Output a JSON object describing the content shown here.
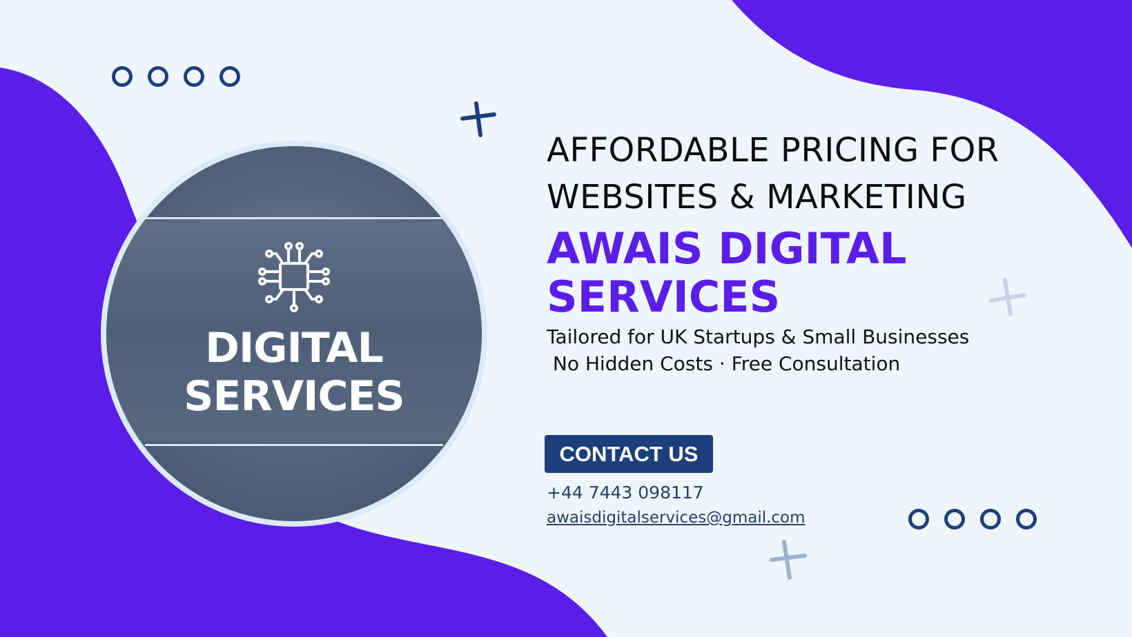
{
  "colors": {
    "background": "#eef5fc",
    "accent_purple": "#5b1ee8",
    "navy": "#1c3f7c"
  },
  "icons": [
    "circuit-chip-icon",
    "cross-decoration-icon",
    "ring-dot-icon"
  ],
  "logo": {
    "line1": "DIGITAL",
    "line2": "SERVICES"
  },
  "headline": {
    "line1": "AFFORDABLE PRICING FOR",
    "line2": "WEBSITES & MARKETING"
  },
  "brand": {
    "line1": "AWAIS DIGITAL",
    "line2": "SERVICES"
  },
  "tagline": {
    "line1": "Tailored for UK Startups & Small Businesses",
    "line2": " No Hidden Costs · Free Consultation"
  },
  "contact": {
    "button_label": "CONTACT US",
    "phone": "+44 7443 098117",
    "email": "awaisdigitalservices@gmail.com"
  }
}
